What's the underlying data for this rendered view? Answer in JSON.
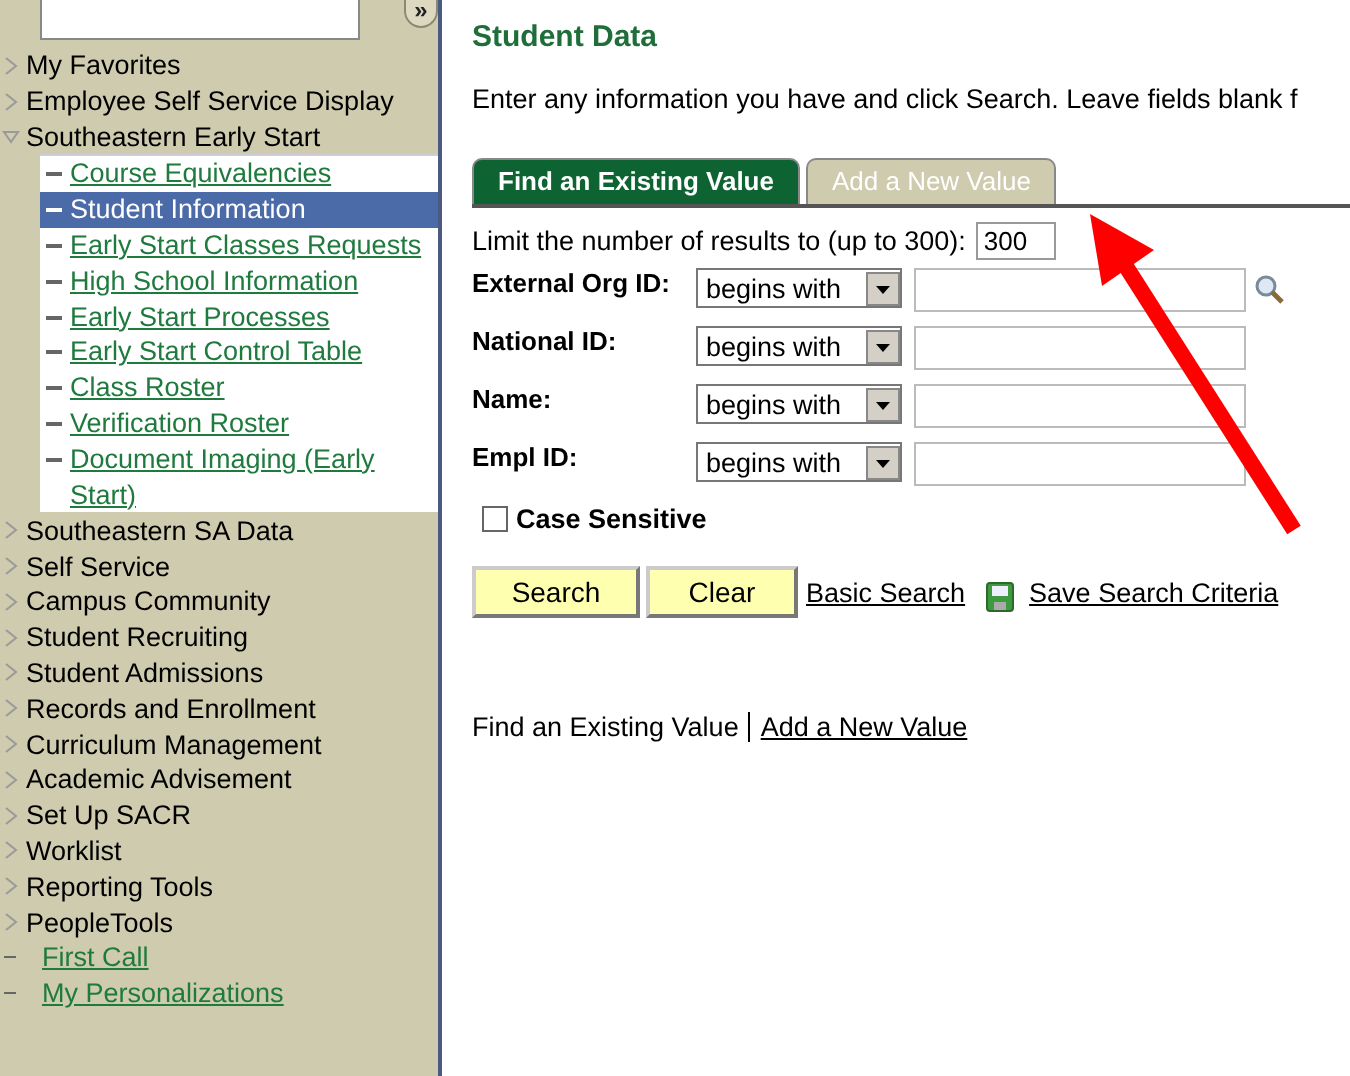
{
  "sidebar": {
    "search_button": "»",
    "items": [
      {
        "label": "My Favorites",
        "kind": "folder",
        "expanded": false
      },
      {
        "label": "Employee Self Service Display",
        "kind": "folder",
        "expanded": false
      },
      {
        "label": "Southeastern Early Start",
        "kind": "folder",
        "expanded": true,
        "children": [
          {
            "label": "Course Equivalencies",
            "selected": false
          },
          {
            "label": "Student Information",
            "selected": true
          },
          {
            "label": "Early Start Classes Requests",
            "selected": false
          },
          {
            "label": "High School Information",
            "selected": false
          },
          {
            "label": "Early Start Processes",
            "selected": false
          },
          {
            "label": "Early Start Control Table",
            "selected": false
          },
          {
            "label": "Class Roster",
            "selected": false
          },
          {
            "label": "Verification Roster",
            "selected": false
          },
          {
            "label": "Document Imaging (Early Start)",
            "selected": false
          }
        ]
      },
      {
        "label": "Southeastern SA Data",
        "kind": "folder",
        "expanded": false
      },
      {
        "label": "Self Service",
        "kind": "folder",
        "expanded": false
      },
      {
        "label": "Campus Community",
        "kind": "folder",
        "expanded": false
      },
      {
        "label": "Student Recruiting",
        "kind": "folder",
        "expanded": false
      },
      {
        "label": "Student Admissions",
        "kind": "folder",
        "expanded": false
      },
      {
        "label": "Records and Enrollment",
        "kind": "folder",
        "expanded": false
      },
      {
        "label": "Curriculum Management",
        "kind": "folder",
        "expanded": false
      },
      {
        "label": "Academic Advisement",
        "kind": "folder",
        "expanded": false
      },
      {
        "label": "Set Up SACR",
        "kind": "folder",
        "expanded": false
      },
      {
        "label": "Worklist",
        "kind": "folder",
        "expanded": false
      },
      {
        "label": "Reporting Tools",
        "kind": "folder",
        "expanded": false
      },
      {
        "label": "PeopleTools",
        "kind": "folder",
        "expanded": false
      },
      {
        "label": "First Call",
        "kind": "link"
      },
      {
        "label": "My Personalizations",
        "kind": "link"
      }
    ]
  },
  "page": {
    "title": "Student Data",
    "instructions": "Enter any information you have and click Search. Leave fields blank f",
    "tabs": [
      {
        "label": "Find an Existing Value",
        "selected": true
      },
      {
        "label": "Add a New Value",
        "selected": false
      }
    ],
    "limit": {
      "label": "Limit the number of results to (up to 300):",
      "value": "300"
    },
    "fields": [
      {
        "label": "External Org ID:",
        "operator": "begins with",
        "lookup": true
      },
      {
        "label": "National ID:",
        "operator": "begins with",
        "lookup": false
      },
      {
        "label": "Name:",
        "operator": "begins with",
        "lookup": false
      },
      {
        "label": "Empl ID:",
        "operator": "begins with",
        "lookup": false
      }
    ],
    "case_sensitive": {
      "label": "Case Sensitive",
      "checked": false
    },
    "buttons": [
      "Search",
      "Clear"
    ],
    "links": [
      {
        "label": "Basic Search",
        "icon": false
      },
      {
        "label": "Save Search Criteria",
        "icon": true
      }
    ],
    "footer": [
      {
        "label": "Find an Existing Value",
        "kind": "text"
      },
      {
        "label": "Add a New Value",
        "kind": "link"
      }
    ]
  },
  "annotation": {
    "kind": "arrow"
  }
}
